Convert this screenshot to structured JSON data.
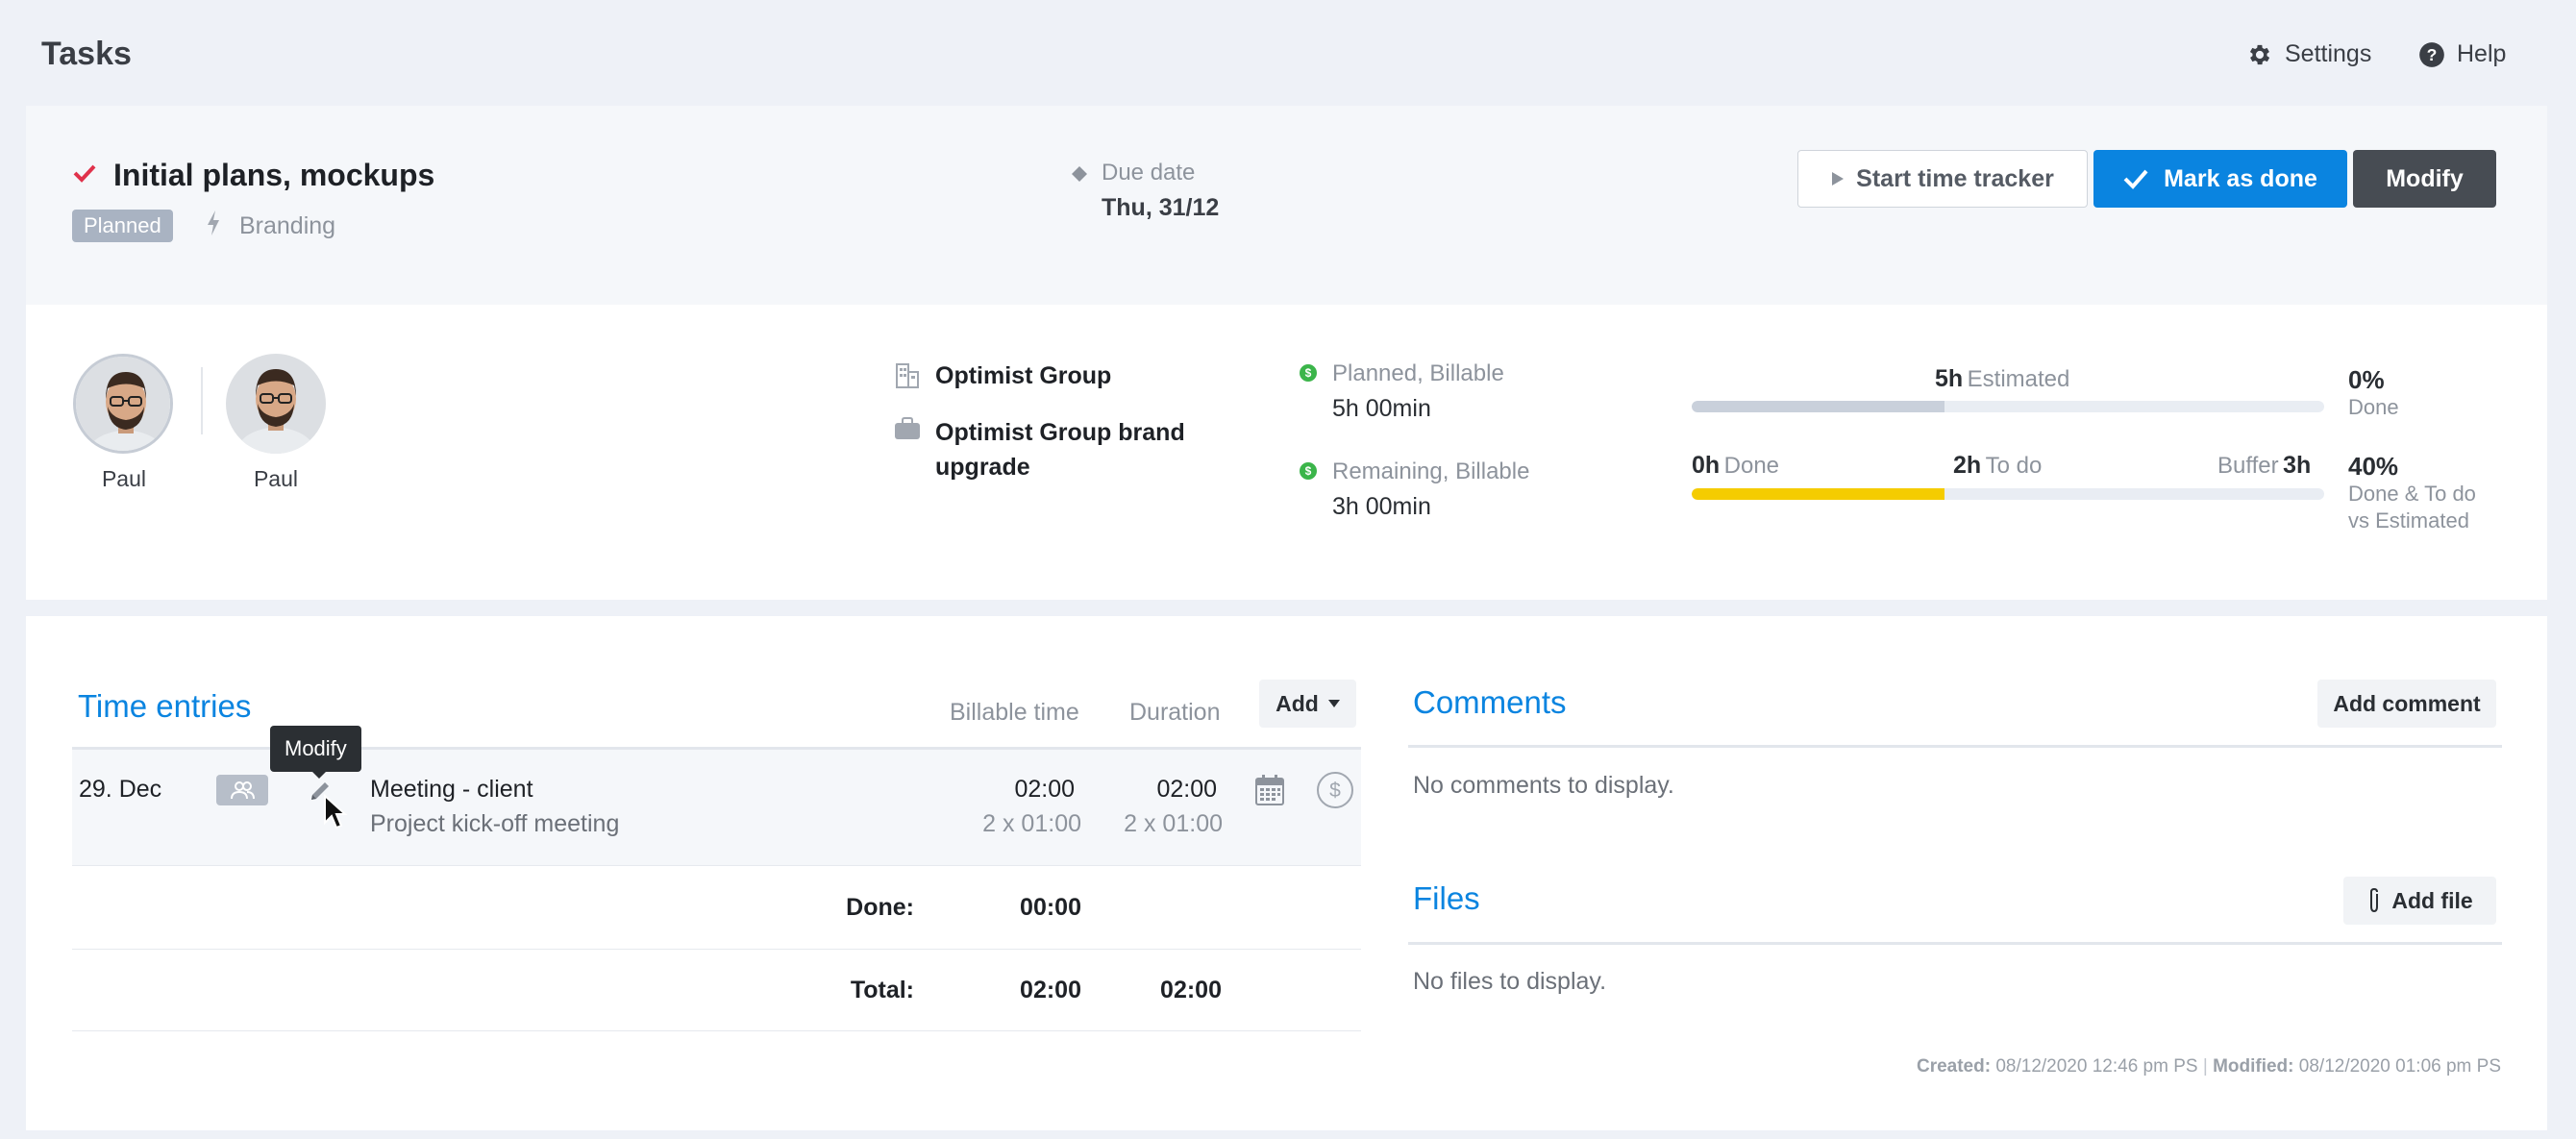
{
  "app": {
    "title": "Tasks",
    "settings_label": "Settings",
    "help_label": "Help"
  },
  "task": {
    "title": "Initial plans, mockups",
    "status": "Planned",
    "tag": "Branding",
    "due_label": "Due date",
    "due_value": "Thu, 31/12",
    "actions": {
      "start_tracker": "Start time tracker",
      "mark_done": "Mark as done",
      "modify": "Modify"
    }
  },
  "people": [
    {
      "name": "Paul"
    },
    {
      "name": "Paul"
    }
  ],
  "client": {
    "company": "Optimist Group",
    "project": "Optimist Group brand upgrade"
  },
  "stats": {
    "planned_label": "Planned, Billable",
    "planned_value": "5h 00min",
    "remaining_label": "Remaining, Billable",
    "remaining_value": "3h 00min",
    "estimated_num": "5h",
    "estimated_label": "Estimated",
    "estimated_fill": 0.4,
    "done_num": "0h",
    "done_label": "Done",
    "todo_num": "2h",
    "todo_label": "To do",
    "buffer_label": "Buffer",
    "buffer_num": "3h",
    "progress_fill": 0.4,
    "done_pct": "0%",
    "done_pct_label": "Done",
    "combined_pct": "40%",
    "combined_line1": "Done & To do",
    "combined_line2": "vs Estimated"
  },
  "time_entries": {
    "title": "Time entries",
    "col_billable": "Billable time",
    "col_duration": "Duration",
    "add_label": "Add",
    "entries": [
      {
        "date": "29. Dec",
        "title": "Meeting - client",
        "description": "Project kick-off meeting",
        "billable": "02:00",
        "billable_detail": "2 x 01:00",
        "duration": "02:00",
        "duration_detail": "2 x 01:00"
      }
    ],
    "done_label": "Done:",
    "done_value": "00:00",
    "total_label": "Total:",
    "total_billable": "02:00",
    "total_duration": "02:00",
    "tooltip": "Modify"
  },
  "comments": {
    "title": "Comments",
    "add_label": "Add comment",
    "empty": "No comments to display."
  },
  "files": {
    "title": "Files",
    "add_label": "Add file",
    "empty": "No files to display."
  },
  "meta": {
    "created_label": "Created:",
    "created_value": "08/12/2020 12:46 pm PS",
    "modified_label": "Modified:",
    "modified_value": "08/12/2020 01:06 pm PS"
  },
  "colors": {
    "accent": "#0a84e0",
    "dark_button": "#474c53",
    "progress": "#f5cc00",
    "estimated_bar": "#c9d0db",
    "success": "#3bb54a",
    "check": "#e0324b"
  }
}
